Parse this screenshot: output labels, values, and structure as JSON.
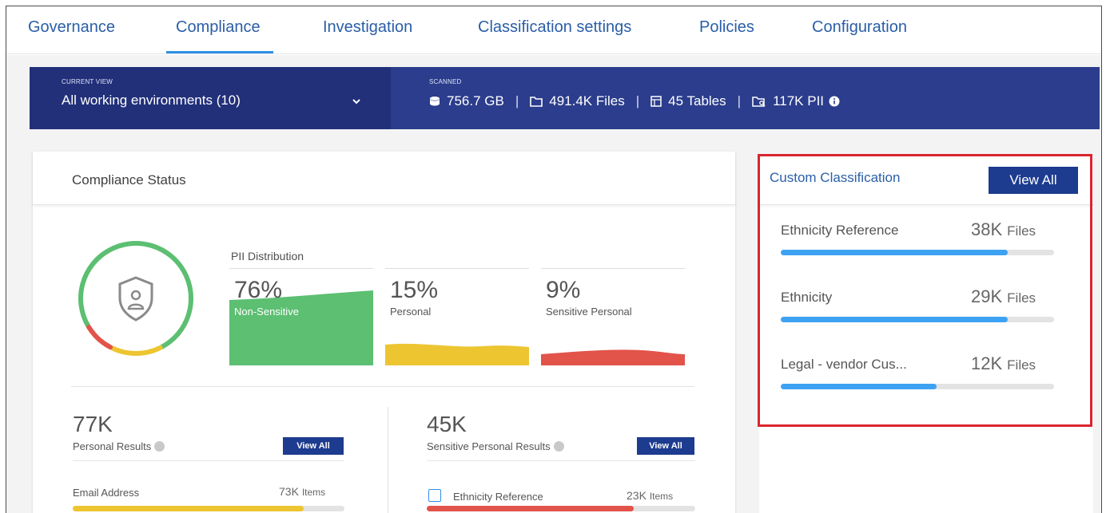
{
  "tabs": [
    {
      "label": "Governance",
      "active": false
    },
    {
      "label": "Compliance",
      "active": true
    },
    {
      "label": "Investigation",
      "active": false
    },
    {
      "label": "Classification settings",
      "active": false
    },
    {
      "label": "Policies",
      "active": false
    },
    {
      "label": "Configuration",
      "active": false
    }
  ],
  "topbar": {
    "current_view_label": "CURRENT VIEW",
    "current_view_value": "All working environments (10)",
    "scanned_label": "SCANNED",
    "size": "756.7 GB",
    "files": "491.4K Files",
    "tables": "45 Tables",
    "pii": "117K PII"
  },
  "compliance": {
    "title": "Compliance Status",
    "pii_distribution_label": "PII Distribution",
    "distribution": [
      {
        "pct": "76%",
        "label": "Non-Sensitive",
        "color": "#5cbf72"
      },
      {
        "pct": "15%",
        "label": "Personal",
        "color": "#ecc531"
      },
      {
        "pct": "9%",
        "label": "Sensitive Personal",
        "color": "#e2534a"
      }
    ],
    "ring_segments": [
      {
        "color": "#5cbf72",
        "fraction": 0.76
      },
      {
        "color": "#ecc531",
        "fraction": 0.15
      },
      {
        "color": "#e2534a",
        "fraction": 0.09
      }
    ],
    "personal": {
      "count": "77K",
      "label": "Personal Results",
      "button": "View All",
      "rows": [
        {
          "name": "Email Address",
          "value": "73K",
          "unit": "Items",
          "fraction": 0.85,
          "color": "#ecc531"
        }
      ]
    },
    "sensitive": {
      "count": "45K",
      "label": "Sensitive Personal Results",
      "button": "View All",
      "rows": [
        {
          "name": "Ethnicity Reference",
          "value": "23K",
          "unit": "Items",
          "fraction": 0.77,
          "color": "#e2534a"
        }
      ]
    }
  },
  "custom_classification": {
    "title": "Custom Classification",
    "button": "View All",
    "unit": "Files",
    "items": [
      {
        "name": "Ethnicity Reference",
        "value": "38K",
        "fraction": 0.83
      },
      {
        "name": "Ethnicity",
        "value": "29K",
        "fraction": 0.83
      },
      {
        "name": "Legal - vendor Cus...",
        "value": "12K",
        "fraction": 0.57
      }
    ],
    "bar_color": "#3ea2f2"
  }
}
